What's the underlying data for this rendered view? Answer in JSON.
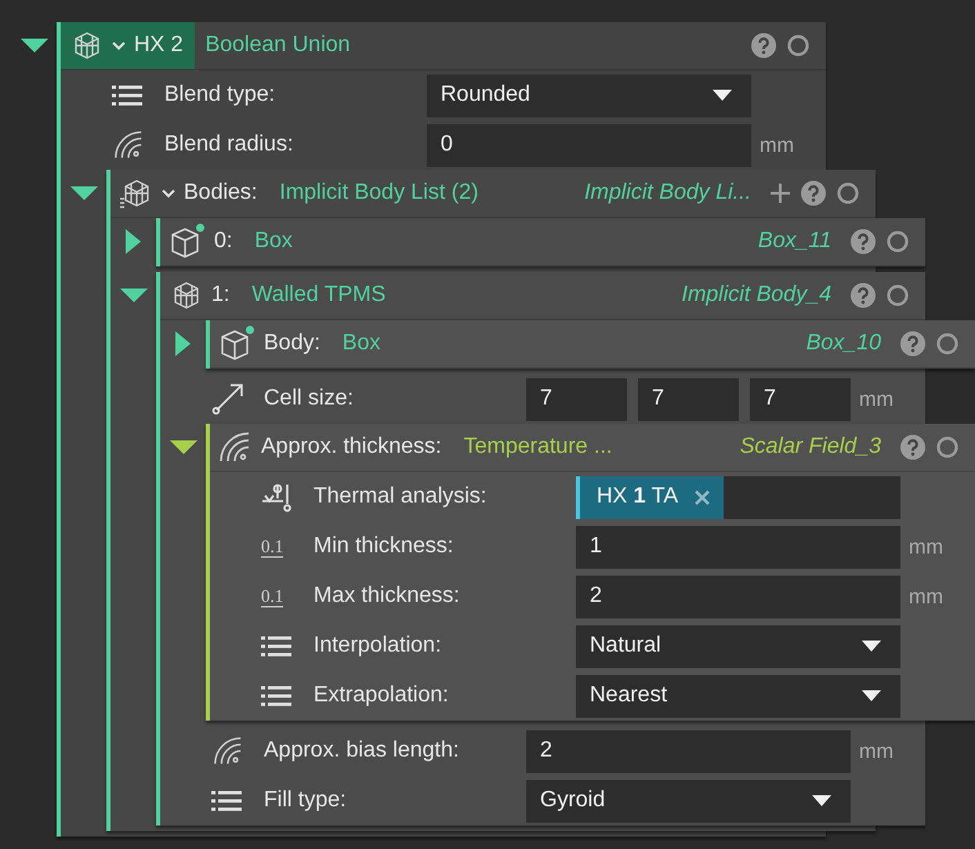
{
  "node": {
    "kind": "union",
    "expanded": true,
    "highlighted": true,
    "menu": true,
    "color": "#4fd1a0",
    "label": "HX 2",
    "type": "Boolean Union",
    "children": [
      {
        "kind": "dropdown",
        "label": "Blend type:",
        "value": "Rounded"
      },
      {
        "kind": "number",
        "label": "Blend radius:",
        "value": "0",
        "unit": "mm"
      },
      {
        "kind": "list",
        "expanded": true,
        "menu": true,
        "add": true,
        "color": "#4fd1a0",
        "label": "Bodies:",
        "type": "Implicit Body List (2)",
        "instance": "Implicit Body Li...",
        "children": [
          {
            "kind": "box",
            "modified": true,
            "expanded": false,
            "color": "#4fd1a0",
            "label": "0:",
            "type": "Box",
            "instance": "Box_11"
          },
          {
            "kind": "tpms",
            "expanded": true,
            "color": "#4fd1a0",
            "label": "1:",
            "type": "Walled TPMS",
            "instance": "Implicit Body_4",
            "children": [
              {
                "kind": "box",
                "modified": true,
                "expanded": false,
                "color": "#4fd1a0",
                "label": "Body:",
                "type": "Box",
                "instance": "Box_10"
              },
              {
                "kind": "vector",
                "label": "Cell size:",
                "values": [
                  "7",
                  "7",
                  "7"
                ],
                "unit": "mm"
              },
              {
                "kind": "field",
                "expanded": true,
                "color": "#a6cf4a",
                "label": "Approx. thickness:",
                "type": "Temperature ...",
                "instance": "Scalar Field_3",
                "children": [
                  {
                    "kind": "tag",
                    "label": "Thermal analysis:",
                    "tag": "HX **1** TA"
                  },
                  {
                    "kind": "number",
                    "badge": "0.1",
                    "label": "Min thickness:",
                    "value": "1",
                    "unit": "mm"
                  },
                  {
                    "kind": "number",
                    "badge": "0.1",
                    "label": "Max thickness:",
                    "value": "2",
                    "unit": "mm"
                  },
                  {
                    "kind": "dropdown",
                    "label": "Interpolation:",
                    "value": "Natural"
                  },
                  {
                    "kind": "dropdown",
                    "label": "Extrapolation:",
                    "value": "Nearest"
                  }
                ]
              },
              {
                "kind": "number",
                "label": "Approx. bias length:",
                "value": "2",
                "unit": "mm"
              },
              {
                "kind": "dropdown",
                "label": "Fill type:",
                "value": "Gyroid"
              }
            ]
          }
        ]
      }
    ]
  }
}
